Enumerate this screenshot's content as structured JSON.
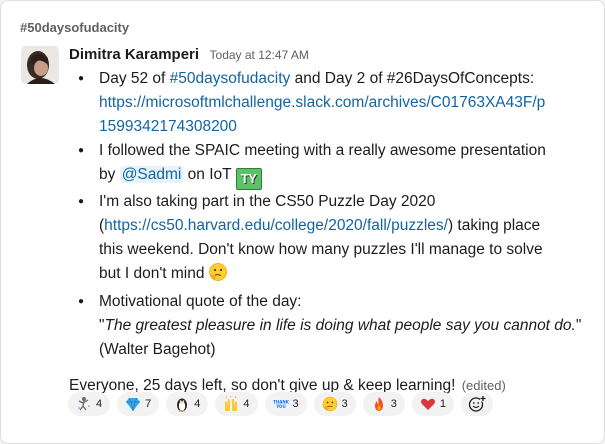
{
  "channel": "#50daysofudacity",
  "message": {
    "author": "Dimitra Karamperi",
    "timestamp": "Today at 12:47 AM",
    "bullets": [
      {
        "pre": "Day 52 of ",
        "link1": "#50daysofudacity",
        "mid": " and Day 2 of #26DaysOfConcepts:",
        "url_line1": "https://microsoftmlchallenge.slack.com/archives/C01763XA43F/p",
        "url_line2": "1599342174308200"
      },
      {
        "line1": "I followed the SPAIC meeting with a really awesome presentation",
        "pre": "by ",
        "mention": "@Sadmi",
        "post": " on IoT",
        "emoji_text": "TY"
      },
      {
        "line1": "I'm also taking part in the CS50 Puzzle Day 2020",
        "open": "(",
        "url": "https://cs50.harvard.edu/college/2020/fall/puzzles/",
        "close": ") taking place",
        "line3": "this weekend. Don't know how many puzzles I'll manage to solve",
        "line4": "but I don't mind"
      },
      {
        "line1": "Motivational quote of the day:",
        "quote_open": "\"",
        "quote": "The greatest pleasure in life is doing what people say you cannot do.",
        "quote_close": "\"",
        "attribution": "(Walter Bagehot)"
      }
    ],
    "closing": "Everyone, 25 days left, so don't give up & keep learning!",
    "edited": "(edited)"
  },
  "reactions": [
    {
      "icon": "dancing-figure-icon",
      "count": "4"
    },
    {
      "icon": "gem-icon",
      "count": "7"
    },
    {
      "icon": "penguin-icon",
      "count": "4"
    },
    {
      "icon": "raised-hands-icon",
      "count": "4"
    },
    {
      "icon": "thank-you-icon",
      "count": "3",
      "text": "THANK YOU"
    },
    {
      "icon": "thinking-face-icon",
      "count": "3"
    },
    {
      "icon": "fire-icon",
      "count": "3"
    },
    {
      "icon": "heart-icon",
      "count": "1"
    }
  ],
  "colors": {
    "link": "#1264a3",
    "text": "#1d1c1d",
    "muted": "#616061",
    "reaction_bg": "#f2f2f2"
  }
}
